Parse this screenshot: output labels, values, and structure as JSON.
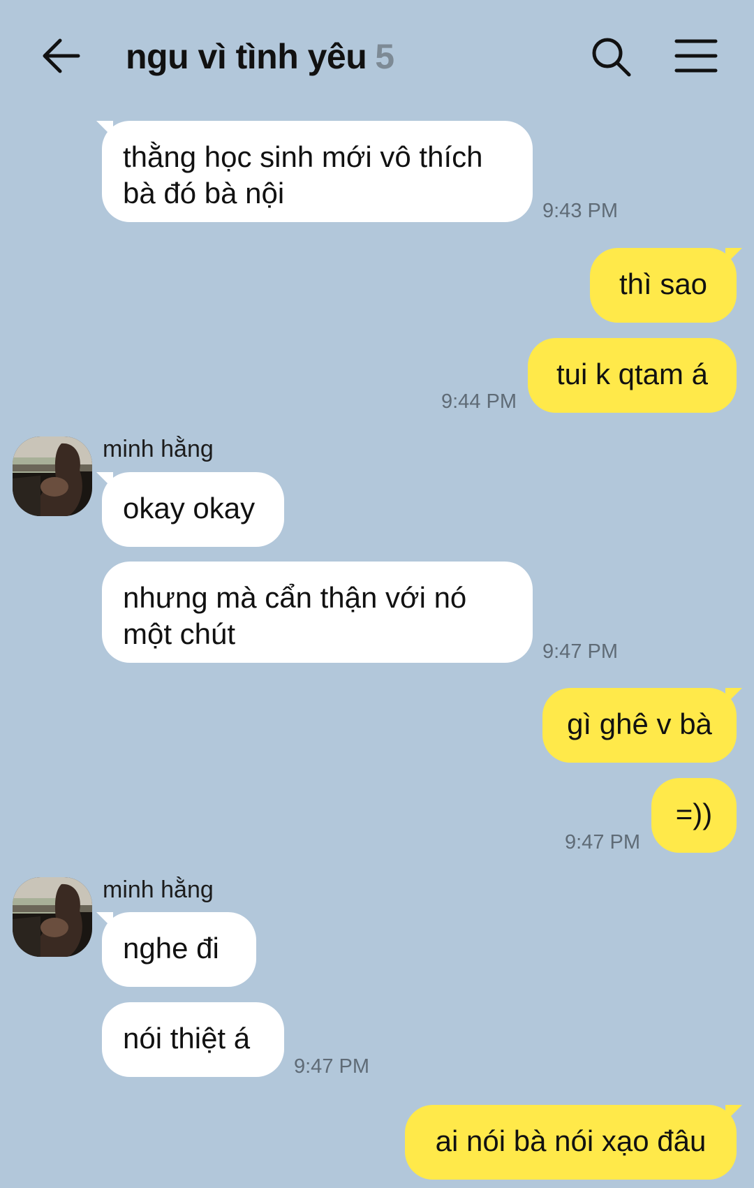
{
  "header": {
    "title": "ngu vì tình yêu",
    "member_count": "5",
    "back_icon": "arrow-left-icon",
    "search_icon": "search-icon",
    "menu_icon": "hamburger-menu-icon"
  },
  "colors": {
    "background": "#b2c7da",
    "incoming_bubble": "#ffffff",
    "outgoing_bubble": "#ffe94a",
    "timestamp": "#5f6b76"
  },
  "messages": [
    {
      "direction": "in",
      "text": "thằng học sinh mới vô thích bà đó bà nội",
      "time": "9:43 PM"
    },
    {
      "direction": "out",
      "text": "thì sao"
    },
    {
      "direction": "out",
      "text": "tui k qtam á",
      "time": "9:44 PM"
    },
    {
      "direction": "in",
      "sender": "minh hằng",
      "text": "okay okay"
    },
    {
      "direction": "in",
      "text": "nhưng mà cẩn thận với nó một chút",
      "time": "9:47 PM"
    },
    {
      "direction": "out",
      "text": "gì ghê v bà"
    },
    {
      "direction": "out",
      "text": "=))",
      "time": "9:47 PM"
    },
    {
      "direction": "in",
      "sender": "minh hằng",
      "text": "nghe đi"
    },
    {
      "direction": "in",
      "text": "nói thiệt á",
      "time": "9:47 PM"
    },
    {
      "direction": "out",
      "text": "ai nói bà nói xạo đâu"
    }
  ]
}
